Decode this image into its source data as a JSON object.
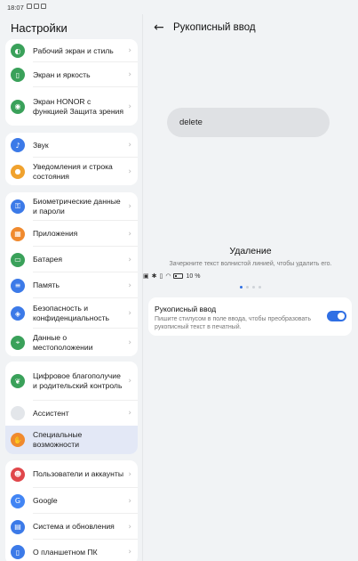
{
  "status": {
    "time": "18:07",
    "battery": "10 %",
    "accent": "#2f6fe4"
  },
  "left": {
    "title": "Настройки",
    "groups": [
      [
        {
          "label": "Рабочий экран и стиль",
          "icon": "palette-icon",
          "color": "#3aa15a"
        },
        {
          "label": "Экран и яркость",
          "icon": "display-icon",
          "color": "#3aa15a"
        },
        {
          "label": "Экран HONOR с функцией Защита зрения",
          "icon": "eye-comfort-icon",
          "color": "#3aa15a"
        }
      ],
      [
        {
          "label": "Звук",
          "icon": "sound-icon",
          "color": "#3c7ae8"
        },
        {
          "label": "Уведомления и строка состояния",
          "icon": "notification-bell-icon",
          "color": "#f0a22e"
        }
      ],
      [
        {
          "label": "Биометрические данные и пароли",
          "icon": "key-icon",
          "color": "#3c7ae8"
        },
        {
          "label": "Приложения",
          "icon": "apps-grid-icon",
          "color": "#f08a2e"
        },
        {
          "label": "Батарея",
          "icon": "battery-icon",
          "color": "#3aa15a"
        },
        {
          "label": "Память",
          "icon": "storage-icon",
          "color": "#3c7ae8"
        },
        {
          "label": "Безопасность и конфиденциальность",
          "icon": "shield-icon",
          "color": "#3c7ae8"
        },
        {
          "label": "Данные о местоположении",
          "icon": "location-pin-icon",
          "color": "#3aa15a"
        }
      ],
      [
        {
          "label": "Цифровое благополучие и родительский контроль",
          "icon": "wellbeing-icon",
          "color": "#3aa15a"
        },
        {
          "label": "Ассистент",
          "icon": "assistant-icon",
          "color": "#d8dce2"
        },
        {
          "label": "Специальные возможности",
          "icon": "accessibility-hand-icon",
          "color": "#f08a2e",
          "selected": true
        }
      ],
      [
        {
          "label": "Пользователи и аккаунты",
          "icon": "user-accounts-icon",
          "color": "#e0474b"
        },
        {
          "label": "Google",
          "icon": "google-icon",
          "color": "#4285f4"
        },
        {
          "label": "Система и обновления",
          "icon": "system-update-icon",
          "color": "#3c7ae8"
        },
        {
          "label": "О планшетном ПК",
          "icon": "tablet-info-icon",
          "color": "#3c7ae8"
        }
      ]
    ]
  },
  "right": {
    "title": "Рукописный ввод",
    "sample_text": "delete",
    "demo_title": "Удаление",
    "demo_desc": "Зачеркните текст волнистой линией, чтобы удалить его.",
    "setting": {
      "title": "Рукописный ввод",
      "desc": "Пишите стилусом в поле ввода, чтобы преобразовать рукописный текст в печатный.",
      "enabled": true
    }
  }
}
